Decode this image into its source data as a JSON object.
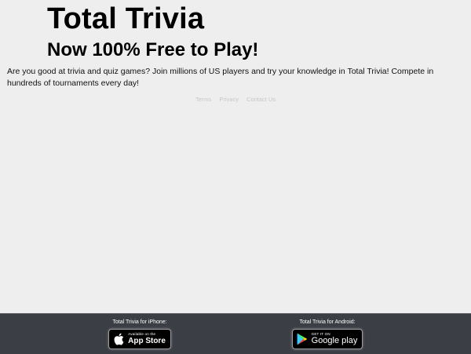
{
  "header": {
    "title": "Total Trivia",
    "subtitle": "Now 100% Free to Play!"
  },
  "intro": "Are you good at trivia and quiz games? Join millions of US players and try your knowledge in Total Trivia! Compete in hundreds of tournaments every day!",
  "footer_links": {
    "terms": "Terms",
    "privacy": "Privacy",
    "contact": "Contact Us"
  },
  "app_bar": {
    "ios": {
      "label": "Total Trivia for iPhone:",
      "badge_small": "Available on the",
      "badge_big": "App Store",
      "icon": "apple-icon"
    },
    "android": {
      "label": "Total Trivia for Android:",
      "badge_small": "GET IT ON",
      "badge_big": "Google play",
      "icon": "google-play-icon"
    }
  },
  "colors": {
    "background": "#eeeeee",
    "app_bar": "#3c3e46",
    "link": "#c7c7c7"
  }
}
